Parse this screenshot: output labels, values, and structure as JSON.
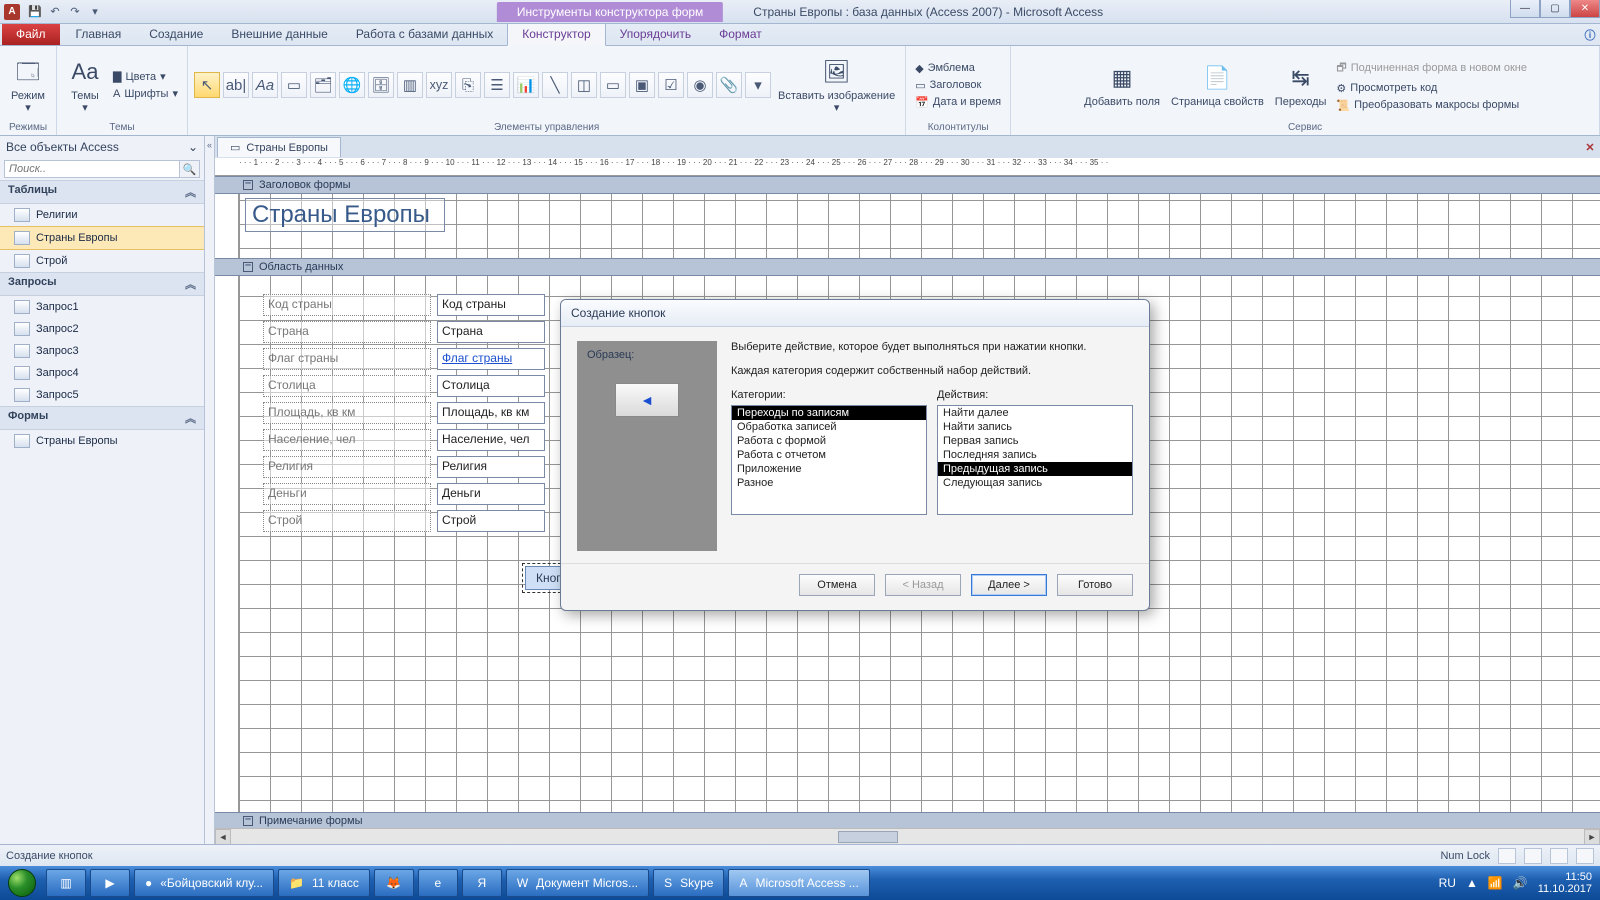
{
  "titlebar": {
    "contextual_tab": "Инструменты конструктора форм",
    "doc_title": "Страны Европы : база данных (Access 2007)  -  Microsoft Access",
    "app_letter": "A"
  },
  "tabs": {
    "file": "Файл",
    "items": [
      "Главная",
      "Создание",
      "Внешние данные",
      "Работа с базами данных"
    ],
    "context_items": [
      "Конструктор",
      "Упорядочить",
      "Формат"
    ],
    "active": "Конструктор"
  },
  "ribbon": {
    "group_modes": "Режимы",
    "btn_mode": "Режим",
    "group_themes": "Темы",
    "btn_themes": "Темы",
    "btn_colors": "Цвета",
    "btn_fonts": "Шрифты",
    "group_controls": "Элементы управления",
    "group_headerfooter": "Колонтитулы",
    "btn_insert_image": "Вставить изображение",
    "btn_logo": "Эмблема",
    "btn_title": "Заголовок",
    "btn_datetime": "Дата и время",
    "group_tools": "Сервис",
    "btn_add_fields": "Добавить поля",
    "btn_prop_sheet": "Страница свойств",
    "btn_tab_order": "Переходы",
    "btn_subform": "Подчиненная форма в новом окне",
    "btn_view_code": "Просмотреть код",
    "btn_convert_macros": "Преобразовать макросы формы"
  },
  "navpane": {
    "header": "Все объекты Access",
    "search_placeholder": "Поиск..",
    "group_tables": "Таблицы",
    "tables": [
      "Религии",
      "Страны Европы",
      "Строй"
    ],
    "group_queries": "Запросы",
    "queries": [
      "Запрос1",
      "Запрос2",
      "Запрос3",
      "Запрос4",
      "Запрос5"
    ],
    "group_forms": "Формы",
    "forms": [
      "Страны Европы"
    ]
  },
  "doc_tab": "Страны Европы",
  "ruler_text": "· · · 1 · · · 2 · · · 3 · · · 4 · · · 5 · · · 6 · · · 7 · · · 8 · · · 9 · · · 10 · · · 11 · · · 12 · · · 13 · · · 14 · · · 15 · · · 16 · · · 17 · · · 18 · · · 19 · · · 20 · · · 21 · · · 22 · · · 23 · · · 24 · · · 25 · · · 26 · · · 27 · · · 28 · · · 29 · · · 30 · · · 31 · · · 32 · · · 33 · · · 34 · · · 35 · ·",
  "sections": {
    "header": "Заголовок формы",
    "detail": "Область данных",
    "footer": "Примечание формы"
  },
  "form_header_title": "Страны Европы",
  "fields": [
    {
      "label": "Код страны",
      "control": "Код страны"
    },
    {
      "label": "Страна",
      "control": "Страна"
    },
    {
      "label": "Флаг страны",
      "control": "Флаг страны",
      "link": true
    },
    {
      "label": "Столица",
      "control": "Столица"
    },
    {
      "label": "Площадь, кв км",
      "control": "Площадь, кв км"
    },
    {
      "label": "Население, чел",
      "control": "Население, чел"
    },
    {
      "label": "Религия",
      "control": "Религия"
    },
    {
      "label": "Деньги",
      "control": "Деньги"
    },
    {
      "label": "Строй",
      "control": "Строй"
    }
  ],
  "form_button_caption": "Кнопка19",
  "wizard": {
    "title": "Создание кнопок",
    "sample_label": "Образец:",
    "instr1": "Выберите действие, которое будет выполняться при нажатии кнопки.",
    "instr2": "Каждая категория содержит собственный набор действий.",
    "categories_label": "Категории:",
    "actions_label": "Действия:",
    "categories": [
      "Переходы по записям",
      "Обработка записей",
      "Работа с формой",
      "Работа с отчетом",
      "Приложение",
      "Разное"
    ],
    "categories_selected": 0,
    "actions": [
      "Найти далее",
      "Найти запись",
      "Первая запись",
      "Последняя запись",
      "Предыдущая запись",
      "Следующая запись"
    ],
    "actions_selected": 4,
    "btn_cancel": "Отмена",
    "btn_back": "< Назад",
    "btn_next": "Далее >",
    "btn_finish": "Готово"
  },
  "statusbar": {
    "left": "Создание кнопок",
    "numlock": "Num Lock"
  },
  "taskbar": {
    "items": [
      {
        "label": "«Бойцовский клу...",
        "icon": "●"
      },
      {
        "label": "11 класс",
        "icon": "📁"
      },
      {
        "label": "",
        "icon": "🦊",
        "iconly": true
      },
      {
        "label": "",
        "icon": "e",
        "iconly": true
      },
      {
        "label": "",
        "icon": "Я",
        "iconly": true
      },
      {
        "label": "Документ Micros...",
        "icon": "W"
      },
      {
        "label": "Skype",
        "icon": "S"
      },
      {
        "label": "Microsoft Access ...",
        "icon": "A",
        "active": true
      }
    ],
    "lang": "RU",
    "time": "11:50",
    "date": "11.10.2017"
  }
}
